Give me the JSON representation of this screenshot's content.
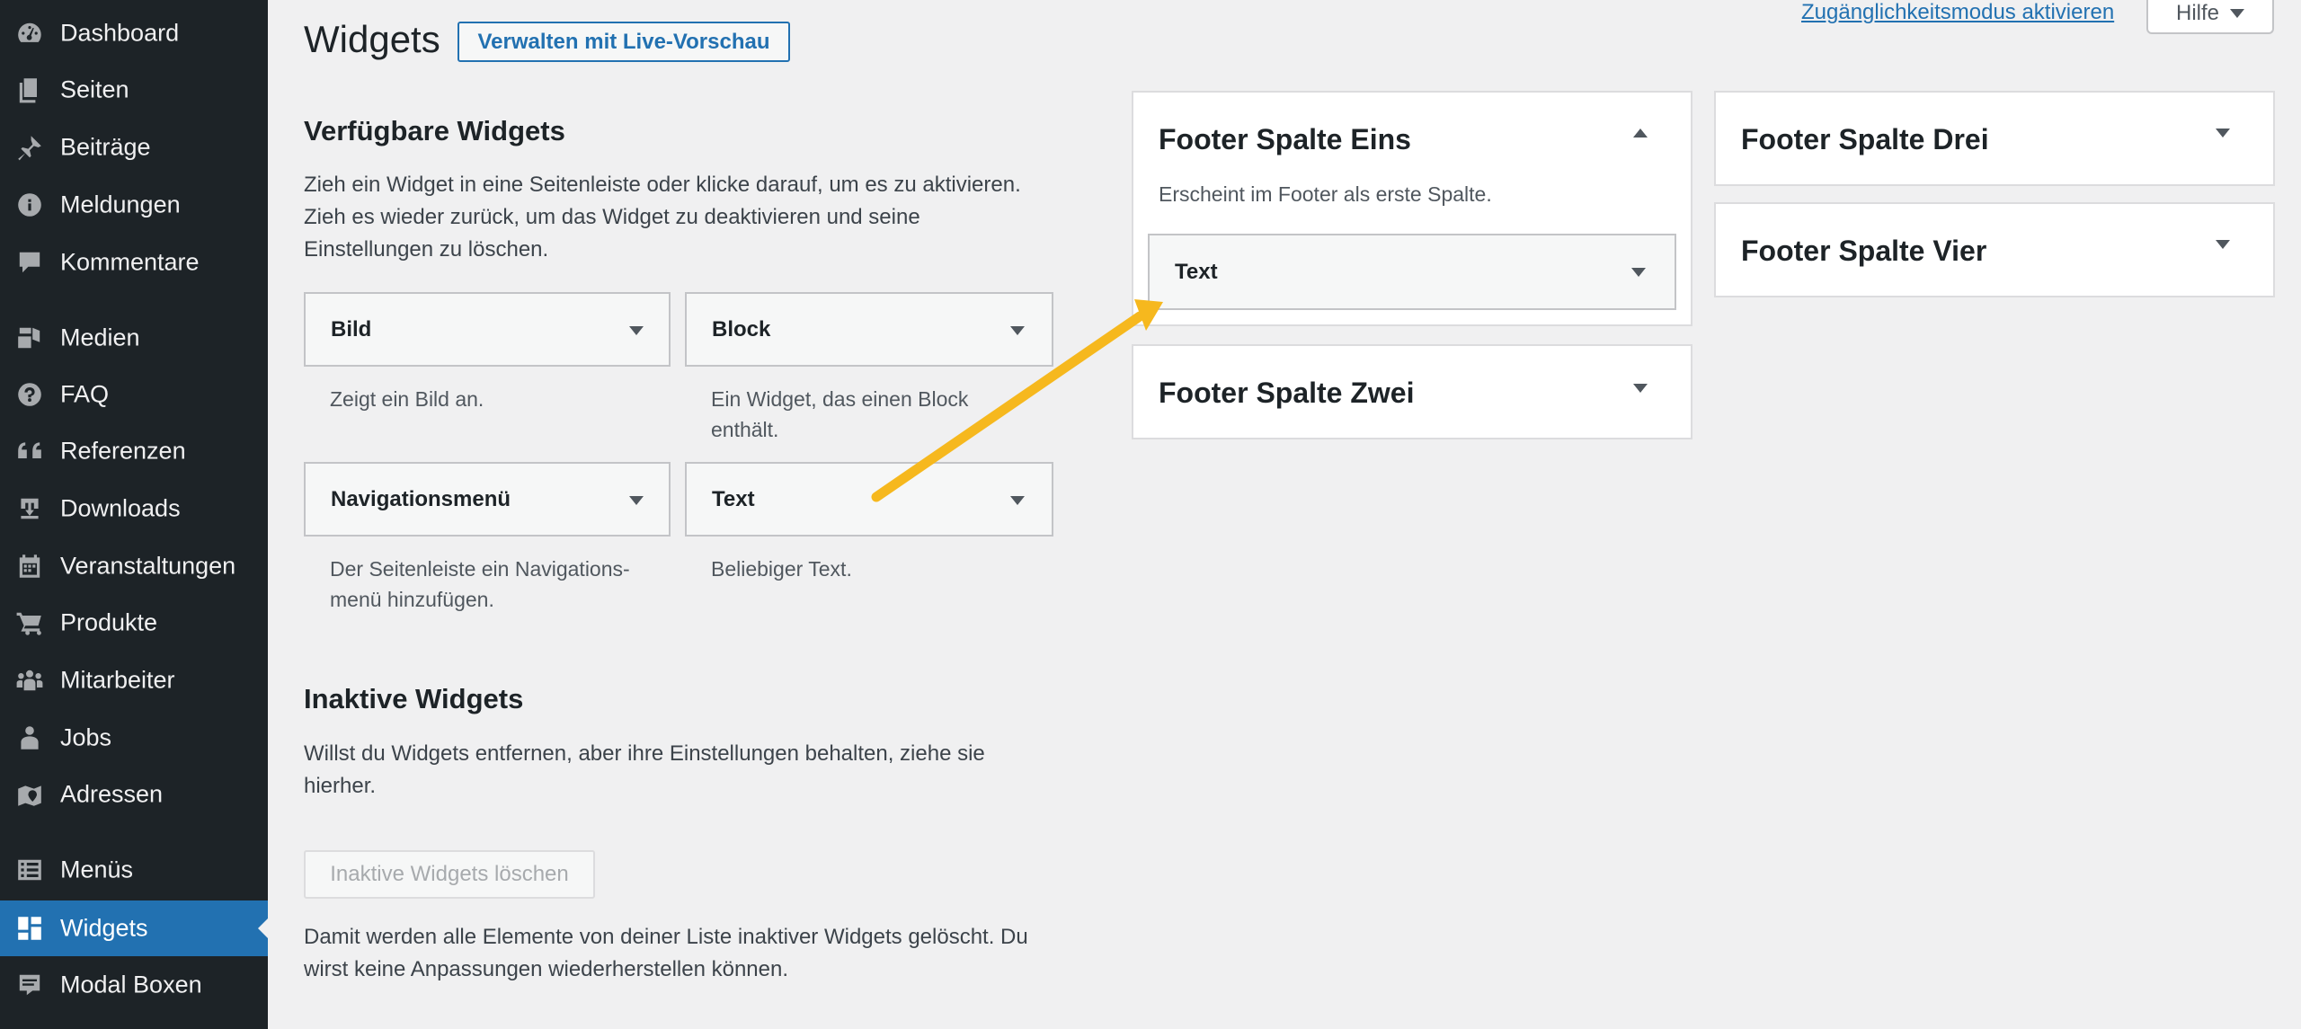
{
  "sidebar": {
    "items": [
      {
        "label": "Dashboard",
        "icon": "dashboard-icon"
      },
      {
        "label": "Seiten",
        "icon": "pages-icon"
      },
      {
        "label": "Beiträge",
        "icon": "pin-icon"
      },
      {
        "label": "Meldungen",
        "icon": "info-icon"
      },
      {
        "label": "Kommentare",
        "icon": "comment-icon"
      },
      {
        "label": "Medien",
        "icon": "media-icon"
      },
      {
        "label": "FAQ",
        "icon": "question-icon"
      },
      {
        "label": "Referenzen",
        "icon": "quote-icon"
      },
      {
        "label": "Downloads",
        "icon": "download-icon"
      },
      {
        "label": "Veranstaltungen",
        "icon": "calendar-icon"
      },
      {
        "label": "Produkte",
        "icon": "cart-icon"
      },
      {
        "label": "Mitarbeiter",
        "icon": "groups-icon"
      },
      {
        "label": "Jobs",
        "icon": "businessperson-icon"
      },
      {
        "label": "Adressen",
        "icon": "location-icon"
      },
      {
        "label": "Menüs",
        "icon": "list-icon"
      },
      {
        "label": "Widgets",
        "icon": "widgets-icon",
        "active": true
      },
      {
        "label": "Modal Boxen",
        "icon": "testimonial-icon"
      }
    ]
  },
  "header": {
    "title": "Widgets",
    "live_preview_button": "Verwalten mit Live-Vorschau",
    "accessibility_link": "Zugänglichkeitsmodus aktivieren",
    "help_button": "Hilfe",
    "help_icon": "caret-down-icon"
  },
  "available": {
    "heading": "Verfügbare Widgets",
    "description": "Zieh ein Widget in eine Seitenleiste oder klicke darauf, um es zu aktivieren. Zieh es wieder zurück, um das Widget zu deaktivieren und seine Einstellungen zu löschen.",
    "widgets": [
      {
        "title": "Bild",
        "desc": "Zeigt ein Bild an."
      },
      {
        "title": "Block",
        "desc": "Ein Widget, das einen Block enthält."
      },
      {
        "title": "Navigationsmenü",
        "desc": "Der Seitenleiste ein Navigations-menü hinzufügen."
      },
      {
        "title": "Text",
        "desc": "Beliebiger Text."
      }
    ]
  },
  "inactive": {
    "heading": "Inaktive Widgets",
    "description": "Willst du Widgets entfernen, aber ihre Einstellungen behalten, ziehe sie hierher.",
    "delete_button": "Inaktive Widgets löschen",
    "note": "Damit werden alle Elemente von deiner Liste inaktiver Widgets gelöscht. Du wirst keine Anpassungen wiederherstellen können."
  },
  "sidebars": {
    "eins": {
      "title": "Footer Spalte Eins",
      "desc": "Erscheint im Footer als erste Spalte.",
      "widget": "Text"
    },
    "zwei": {
      "title": "Footer Spalte Zwei"
    },
    "drei": {
      "title": "Footer Spalte Drei"
    },
    "vier": {
      "title": "Footer Spalte Vier"
    }
  },
  "colors": {
    "admin_bar": "#1d2327",
    "accent": "#2271b1",
    "annotation_arrow": "#f6b81e"
  }
}
